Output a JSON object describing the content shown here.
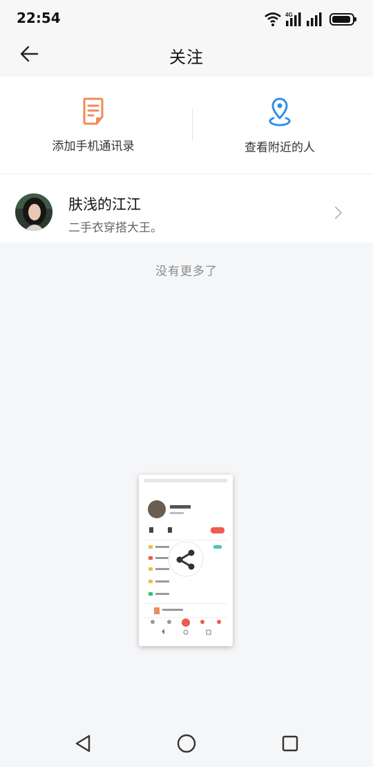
{
  "status_bar": {
    "time": "22:54",
    "network_label": "4G",
    "icons": [
      "wifi-icon",
      "signal-icon",
      "signal-icon",
      "battery-icon"
    ]
  },
  "nav": {
    "title": "关注",
    "back_icon": "arrow-left-icon"
  },
  "actions": {
    "add_contacts": {
      "label": "添加手机通讯录",
      "icon": "document-icon",
      "color": "#f08a5d"
    },
    "nearby": {
      "label": "查看附近的人",
      "icon": "location-pin-icon",
      "color": "#2f8fe8"
    }
  },
  "following": [
    {
      "name": "肤浅的江江",
      "bio": "二手衣穿搭大王。",
      "chevron_icon": "chevron-right-icon"
    }
  ],
  "footer_text": "没有更多了",
  "share_preview": {
    "icon": "share-icon"
  },
  "system_nav": {
    "back_icon": "triangle-back-icon",
    "home_icon": "circle-home-icon",
    "recents_icon": "square-recents-icon"
  }
}
